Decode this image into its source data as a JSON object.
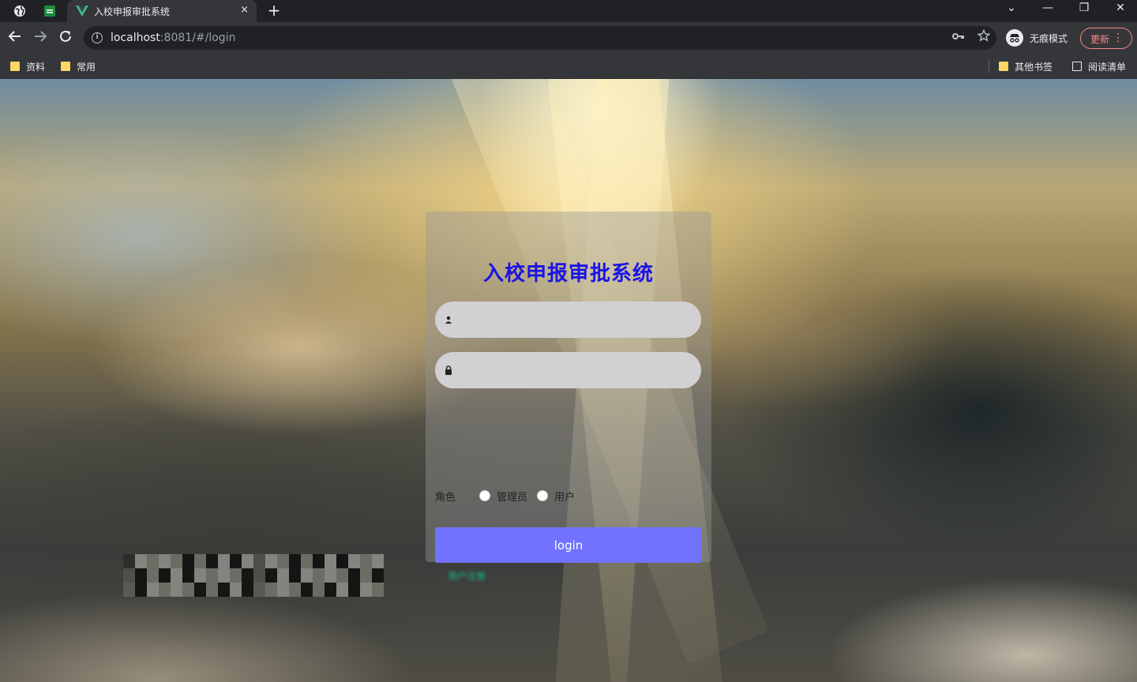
{
  "browser": {
    "tab_title": "入校申报审批系统",
    "tab_close": "×",
    "new_tab": "+",
    "url_host": "localhost",
    "url_rest": ":8081/#/login",
    "incognito_label": "无痕模式",
    "update_label": "更新",
    "update_menu": "⋮",
    "window_controls": {
      "collapse": "⌄",
      "minimize": "—",
      "restore": "❐",
      "close": "✕"
    }
  },
  "bookmarks": {
    "left": [
      {
        "label": "资料"
      },
      {
        "label": "常用"
      }
    ],
    "other": "其他书签",
    "reading_list": "阅读清单"
  },
  "login": {
    "title": "入校申报审批系统",
    "username_placeholder": "",
    "password_placeholder": "",
    "role_label": "角色",
    "roles": [
      "管理员",
      "用户"
    ],
    "submit": "login",
    "register_link": "用户注册"
  },
  "colors": {
    "title": "#1a13e6",
    "button": "#7173ff",
    "register_link": "#14b58a",
    "update_accent": "#f28b82"
  },
  "icons": {
    "username": "user-icon",
    "password": "lock-icon",
    "back": "back-arrow-icon",
    "forward": "forward-arrow-icon",
    "reload": "reload-icon"
  }
}
